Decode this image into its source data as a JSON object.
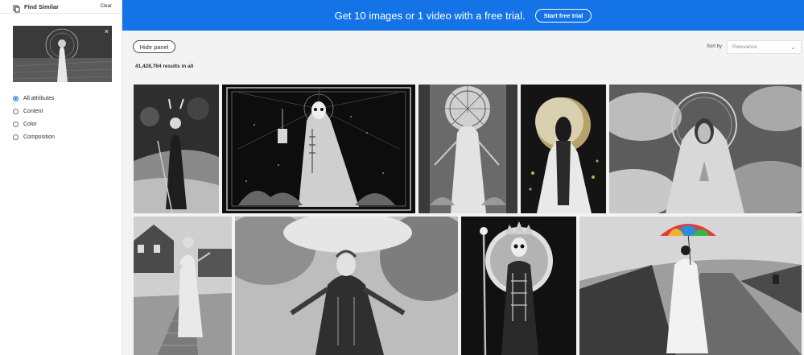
{
  "sidebar": {
    "title": "Find Similar",
    "clear_label": "Clear",
    "close_icon": "×",
    "attributes": [
      {
        "label": "All attributes",
        "selected": true
      },
      {
        "label": "Content",
        "selected": false
      },
      {
        "label": "Color",
        "selected": false
      },
      {
        "label": "Composition",
        "selected": false
      }
    ]
  },
  "banner": {
    "text": "Get 10 images or 1 video with a free trial.",
    "button": "Start free trial",
    "color": "#1473e6"
  },
  "toolbar": {
    "hide_panel": "Hide panel",
    "results": "41,428,764 results in all",
    "sort_label": "Sort by",
    "sort_value": "Relevance"
  },
  "images": [
    {
      "name": "image-woman-with-broom"
    },
    {
      "name": "image-skeleton-with-lantern"
    },
    {
      "name": "image-art-nouveau-goddess"
    },
    {
      "name": "image-moon-figure"
    },
    {
      "name": "image-madonna-praying"
    },
    {
      "name": "image-woman-on-boardwalk"
    },
    {
      "name": "image-woman-in-rain"
    },
    {
      "name": "image-skeleton-queen"
    },
    {
      "name": "image-woman-with-umbrella"
    }
  ]
}
